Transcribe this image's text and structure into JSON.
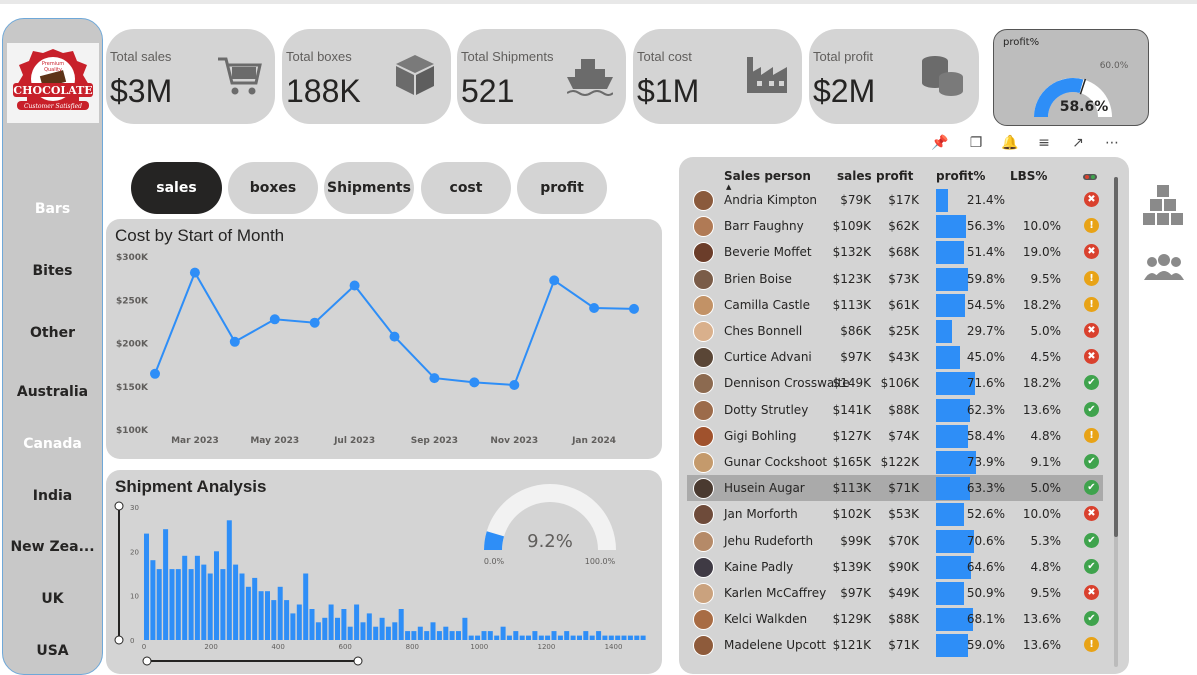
{
  "logo": {
    "alt": "Premium Quality Chocolate Customer Satisfied logo"
  },
  "sidebar": {
    "items": [
      {
        "label": "Bars",
        "selected": true
      },
      {
        "label": "Bites",
        "selected": false
      },
      {
        "label": "Other",
        "selected": false
      },
      {
        "label": "Australia",
        "selected": false
      },
      {
        "label": "Canada",
        "selected": true
      },
      {
        "label": "India",
        "selected": false
      },
      {
        "label": "New Zea...",
        "selected": false
      },
      {
        "label": "UK",
        "selected": false
      },
      {
        "label": "USA",
        "selected": false
      }
    ]
  },
  "kpis": [
    {
      "label": "Total sales",
      "value": "$3M",
      "icon": "shopping-cart-icon"
    },
    {
      "label": "Total boxes",
      "value": "188K",
      "icon": "box-icon"
    },
    {
      "label": "Total Shipments",
      "value": "521",
      "icon": "ship-icon"
    },
    {
      "label": "Total cost",
      "value": "$1M",
      "icon": "factory-icon"
    },
    {
      "label": "Total profit",
      "value": "$2M",
      "icon": "coins-icon"
    }
  ],
  "profit_gauge": {
    "title": "profit%",
    "value": "58.6%",
    "target": "60.0%",
    "fill_fraction": 0.586,
    "target_fraction": 0.6
  },
  "tabs": [
    "sales",
    "boxes",
    "Shipments",
    "cost",
    "profit"
  ],
  "colors": {
    "accent": "#2e8ef7",
    "panel": "#d4d4d4",
    "dark": "#252423"
  },
  "cost_chart": {
    "title": "Cost by Start of Month",
    "chart_data": {
      "type": "line",
      "x": [
        "2023-01",
        "2023-02",
        "2023-03",
        "2023-04",
        "2023-05",
        "2023-06",
        "2023-07",
        "2023-08",
        "2023-09",
        "2023-10",
        "2023-11",
        "2023-12",
        "2024-01",
        "2024-02"
      ],
      "values": [
        165000,
        282000,
        202000,
        228000,
        224000,
        267000,
        208000,
        160000,
        155000,
        152000,
        273000,
        241000,
        240000
      ],
      "x_tick_labels": [
        "Mar 2023",
        "May 2023",
        "Jul 2023",
        "Sep 2023",
        "Nov 2023",
        "Jan 2024"
      ],
      "y_tick_labels": [
        "$300K",
        "$250K",
        "$200K",
        "$150K",
        "$100K"
      ],
      "ylim": [
        100000,
        300000
      ]
    }
  },
  "shipment_chart": {
    "title": "Shipment Analysis",
    "chart_data": {
      "type": "bar",
      "x_tick_labels": [
        "0",
        "200",
        "400",
        "600",
        "800",
        "1000",
        "1200",
        "1400"
      ],
      "y_tick_labels": [
        "30",
        "20",
        "10",
        "0"
      ],
      "xlim": [
        0,
        1500
      ],
      "ylim": [
        0,
        30
      ],
      "values": [
        24,
        18,
        16,
        25,
        16,
        16,
        19,
        16,
        19,
        17,
        15,
        20,
        16,
        27,
        17,
        15,
        12,
        14,
        11,
        11,
        9,
        12,
        9,
        6,
        8,
        15,
        7,
        4,
        5,
        8,
        5,
        7,
        3,
        8,
        4,
        6,
        3,
        5,
        3,
        4,
        7,
        2,
        2,
        3,
        2,
        4,
        2,
        3,
        2,
        2,
        5,
        1,
        1,
        2,
        2,
        1,
        3,
        1,
        2,
        1,
        1,
        2,
        1,
        1,
        2,
        1,
        2,
        1,
        1,
        2,
        1,
        2,
        1,
        1,
        1,
        1,
        1,
        1,
        1
      ],
      "gauge_value": "9.2%",
      "gauge_min": "0.0%",
      "gauge_max": "100.0%",
      "gauge_fraction": 0.092
    }
  },
  "table": {
    "headers": [
      "Sales person",
      "sales",
      "profit",
      "profit%",
      "LBS%"
    ],
    "rows": [
      {
        "name": "Andria Kimpton",
        "sales": "$79K",
        "profit": "$17K",
        "pct": "21.4%",
        "lbs": "",
        "status": "bad",
        "bar": 0.214,
        "av": "#8a5a3c"
      },
      {
        "name": "Barr Faughny",
        "sales": "$109K",
        "profit": "$62K",
        "pct": "56.3%",
        "lbs": "10.0%",
        "status": "warn",
        "bar": 0.563,
        "av": "#b07a55"
      },
      {
        "name": "Beverie Moffet",
        "sales": "$132K",
        "profit": "$68K",
        "pct": "51.4%",
        "lbs": "19.0%",
        "status": "bad",
        "bar": 0.514,
        "av": "#6b3d2a"
      },
      {
        "name": "Brien Boise",
        "sales": "$123K",
        "profit": "$73K",
        "pct": "59.8%",
        "lbs": "9.5%",
        "status": "warn",
        "bar": 0.598,
        "av": "#7a5c48"
      },
      {
        "name": "Camilla Castle",
        "sales": "$113K",
        "profit": "$61K",
        "pct": "54.5%",
        "lbs": "18.2%",
        "status": "warn",
        "bar": 0.545,
        "av": "#c29266"
      },
      {
        "name": "Ches Bonnell",
        "sales": "$86K",
        "profit": "$25K",
        "pct": "29.7%",
        "lbs": "5.0%",
        "status": "bad",
        "bar": 0.297,
        "av": "#d9b08c"
      },
      {
        "name": "Curtice Advani",
        "sales": "$97K",
        "profit": "$43K",
        "pct": "45.0%",
        "lbs": "4.5%",
        "status": "bad",
        "bar": 0.45,
        "av": "#5a4636"
      },
      {
        "name": "Dennison Crosswaite",
        "sales": "$149K",
        "profit": "$106K",
        "pct": "71.6%",
        "lbs": "18.2%",
        "status": "good",
        "bar": 0.716,
        "av": "#8c6a50"
      },
      {
        "name": "Dotty Strutley",
        "sales": "$141K",
        "profit": "$88K",
        "pct": "62.3%",
        "lbs": "13.6%",
        "status": "good",
        "bar": 0.623,
        "av": "#9c6b4a"
      },
      {
        "name": "Gigi Bohling",
        "sales": "$127K",
        "profit": "$74K",
        "pct": "58.4%",
        "lbs": "4.8%",
        "status": "warn",
        "bar": 0.584,
        "av": "#a0522d"
      },
      {
        "name": "Gunar Cockshoot",
        "sales": "$165K",
        "profit": "$122K",
        "pct": "73.9%",
        "lbs": "9.1%",
        "status": "good",
        "bar": 0.739,
        "av": "#c49a6c"
      },
      {
        "name": "Husein Augar",
        "sales": "$113K",
        "profit": "$71K",
        "pct": "63.3%",
        "lbs": "5.0%",
        "status": "good",
        "bar": 0.633,
        "av": "#4a3a30",
        "highlight": true
      },
      {
        "name": "Jan Morforth",
        "sales": "$102K",
        "profit": "$53K",
        "pct": "52.6%",
        "lbs": "10.0%",
        "status": "bad",
        "bar": 0.526,
        "av": "#6e4b3a"
      },
      {
        "name": "Jehu Rudeforth",
        "sales": "$99K",
        "profit": "$70K",
        "pct": "70.6%",
        "lbs": "5.3%",
        "status": "good",
        "bar": 0.706,
        "av": "#b58a68"
      },
      {
        "name": "Kaine Padly",
        "sales": "$139K",
        "profit": "$90K",
        "pct": "64.6%",
        "lbs": "4.8%",
        "status": "good",
        "bar": 0.646,
        "av": "#3f3a44"
      },
      {
        "name": "Karlen McCaffrey",
        "sales": "$97K",
        "profit": "$49K",
        "pct": "50.9%",
        "lbs": "9.5%",
        "status": "bad",
        "bar": 0.509,
        "av": "#caa27e"
      },
      {
        "name": "Kelci Walkden",
        "sales": "$129K",
        "profit": "$88K",
        "pct": "68.1%",
        "lbs": "13.6%",
        "status": "good",
        "bar": 0.681,
        "av": "#a86c44"
      },
      {
        "name": "Madelene Upcott",
        "sales": "$121K",
        "profit": "$71K",
        "pct": "59.0%",
        "lbs": "13.6%",
        "status": "warn",
        "bar": 0.59,
        "av": "#8e5b3b"
      }
    ]
  }
}
